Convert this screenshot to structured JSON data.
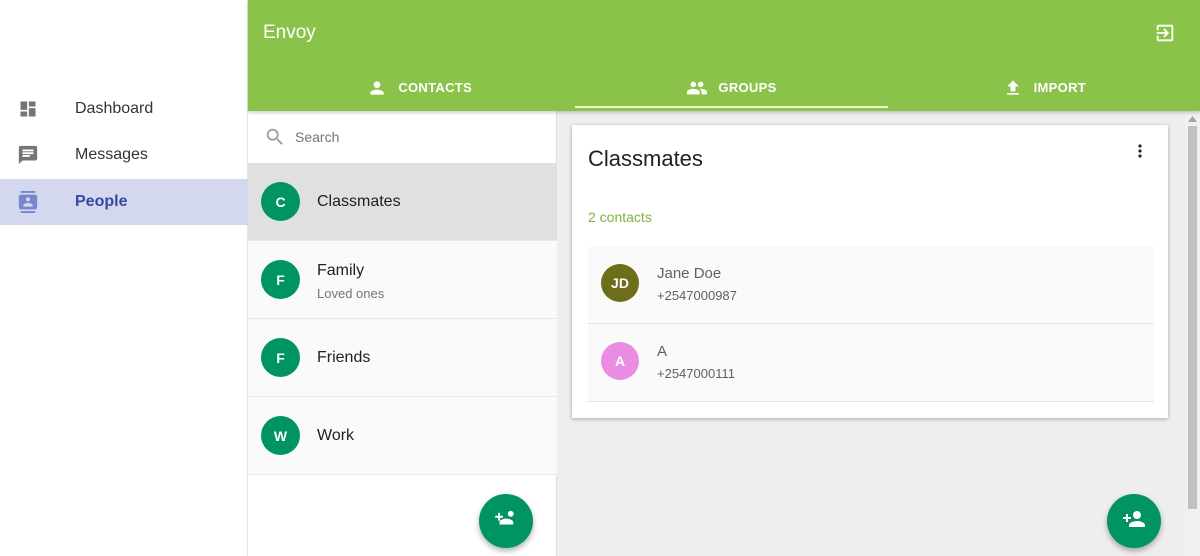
{
  "sidebar": {
    "items": [
      {
        "label": "Dashboard",
        "icon": "dashboard-icon"
      },
      {
        "label": "Messages",
        "icon": "message-icon"
      },
      {
        "label": "People",
        "icon": "contacts-icon",
        "active": true
      }
    ]
  },
  "header": {
    "title": "Envoy",
    "logout_icon": "exit-icon",
    "tabs": [
      {
        "label": "CONTACTS",
        "icon": "person-icon"
      },
      {
        "label": "GROUPS",
        "icon": "group-icon",
        "active": true
      },
      {
        "label": "IMPORT",
        "icon": "upload-icon"
      }
    ]
  },
  "groups": {
    "search_placeholder": "Search",
    "items": [
      {
        "initial": "C",
        "name": "Classmates",
        "description": "",
        "selected": true
      },
      {
        "initial": "F",
        "name": "Family",
        "description": "Loved ones"
      },
      {
        "initial": "F",
        "name": "Friends",
        "description": ""
      },
      {
        "initial": "W",
        "name": "Work",
        "description": ""
      }
    ],
    "fab_icon": "add-group-icon"
  },
  "detail": {
    "title": "Classmates",
    "count": "2 contacts",
    "contacts": [
      {
        "initials": "JD",
        "name": "Jane Doe",
        "phone": "+2547000987",
        "color": "#6d6d1a"
      },
      {
        "initials": "A",
        "name": "A",
        "phone": "+2547000111",
        "color": "#e98ce2"
      }
    ],
    "fab_icon": "add-person-icon"
  },
  "colors": {
    "primary": "#8bc34a",
    "accent": "#009465",
    "active_nav_bg": "#d3d8ef",
    "active_nav_text": "#3847a0"
  }
}
